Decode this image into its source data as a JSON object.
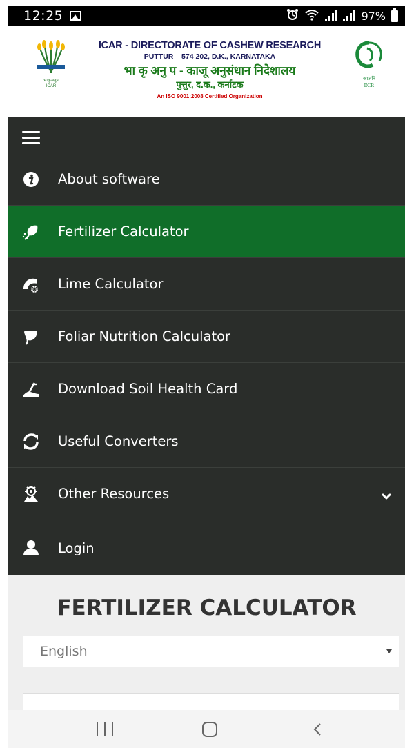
{
  "status_bar": {
    "time": "12:25",
    "battery": "97%",
    "icons": [
      "gallery-icon",
      "alarm-icon",
      "wifi-icon",
      "signal-icon",
      "battery-icon"
    ]
  },
  "header": {
    "line1": "ICAR - DIRECTORATE OF CASHEW RESEARCH",
    "line2": "PUTTUR – 574 202, D.K., KARNATAKA",
    "line3": "भा कृ अनु प - काजू अनुसंधान निदेशालय",
    "line4": "पुत्तुर, द.क., कर्नाटक",
    "line5": "An ISO 9001:2008 Certified Organization",
    "logo_left_label": "ICAR",
    "logo_right_label": "DCR"
  },
  "nav": {
    "menu_icon": "hamburger-icon",
    "items": [
      {
        "label": "About software",
        "icon": "info-icon",
        "active": false
      },
      {
        "label": "Fertilizer Calculator",
        "icon": "fertilizer-icon",
        "active": true
      },
      {
        "label": "Lime Calculator",
        "icon": "lime-icon",
        "active": false
      },
      {
        "label": "Foliar Nutrition Calculator",
        "icon": "leaf-icon",
        "active": false
      },
      {
        "label": "Download Soil Health Card",
        "icon": "soil-icon",
        "active": false
      },
      {
        "label": "Useful Converters",
        "icon": "converter-icon",
        "active": false
      },
      {
        "label": "Other Resources",
        "icon": "resources-icon",
        "active": false,
        "has_dropdown": true
      },
      {
        "label": "Login",
        "icon": "user-icon",
        "active": false
      }
    ]
  },
  "main": {
    "title": "FERTILIZER CALCULATOR",
    "language_select": {
      "selected": "English"
    }
  },
  "colors": {
    "nav_background": "#2a2d2a",
    "active_item": "#106e29",
    "content_background": "#efefef"
  }
}
